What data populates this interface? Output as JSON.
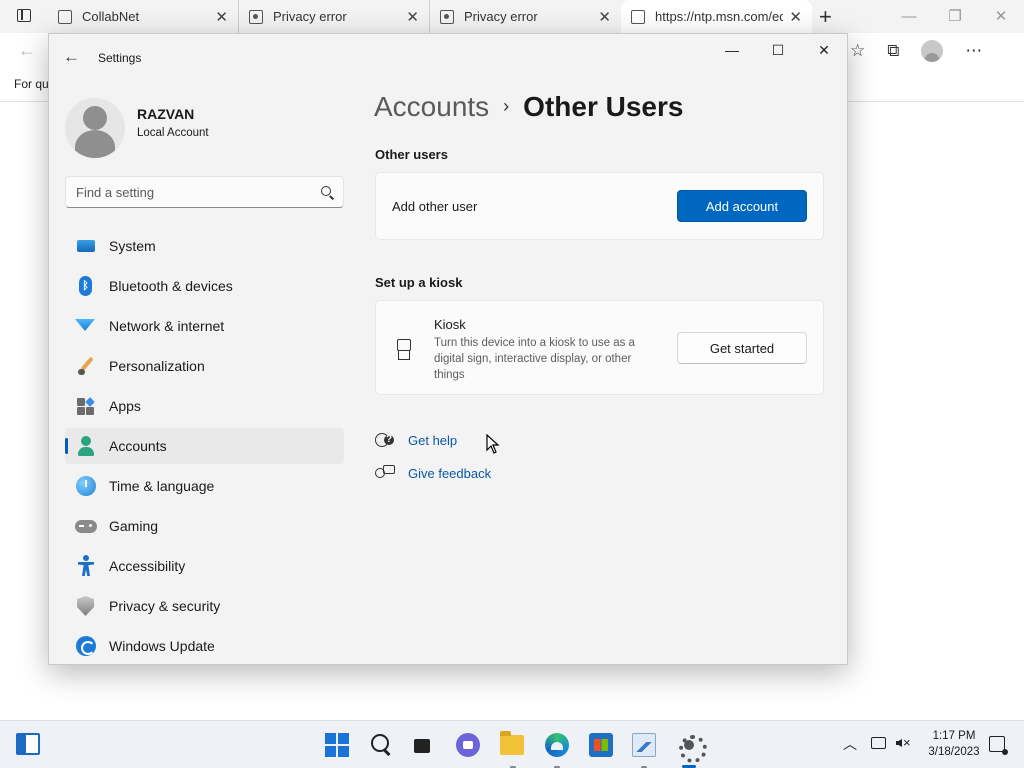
{
  "browser": {
    "tabs": [
      {
        "label": "CollabNet"
      },
      {
        "label": "Privacy error"
      },
      {
        "label": "Privacy error"
      },
      {
        "label": "https://ntp.msn.com/edge"
      }
    ],
    "favorites_bar_text": "For qu"
  },
  "settings": {
    "window_title": "Settings",
    "user": {
      "name": "RAZVAN",
      "account_type": "Local Account"
    },
    "search_placeholder": "Find a setting",
    "nav": [
      {
        "label": "System",
        "icon": "system-icon"
      },
      {
        "label": "Bluetooth & devices",
        "icon": "bluetooth-icon"
      },
      {
        "label": "Network & internet",
        "icon": "network-icon"
      },
      {
        "label": "Personalization",
        "icon": "brush-icon"
      },
      {
        "label": "Apps",
        "icon": "apps-icon"
      },
      {
        "label": "Accounts",
        "icon": "accounts-icon",
        "selected": true
      },
      {
        "label": "Time & language",
        "icon": "globe-clock-icon"
      },
      {
        "label": "Gaming",
        "icon": "gamepad-icon"
      },
      {
        "label": "Accessibility",
        "icon": "accessibility-icon"
      },
      {
        "label": "Privacy & security",
        "icon": "shield-icon"
      },
      {
        "label": "Windows Update",
        "icon": "update-icon"
      }
    ],
    "breadcrumb": {
      "parent": "Accounts",
      "separator": "›",
      "current": "Other Users"
    },
    "other_users": {
      "section_title": "Other users",
      "row_label": "Add other user",
      "button_label": "Add account"
    },
    "kiosk": {
      "section_title": "Set up a kiosk",
      "title": "Kiosk",
      "description": "Turn this device into a kiosk to use as a digital sign, interactive display, or other things",
      "button_label": "Get started"
    },
    "links": {
      "help": "Get help",
      "feedback": "Give feedback"
    }
  },
  "taskbar": {
    "time": "1:17 PM",
    "date": "3/18/2023"
  },
  "colors": {
    "accent": "#0067c0",
    "link": "#0a58a8",
    "window_bg": "#f3f3f3",
    "card_bg": "#fbfbfb"
  }
}
